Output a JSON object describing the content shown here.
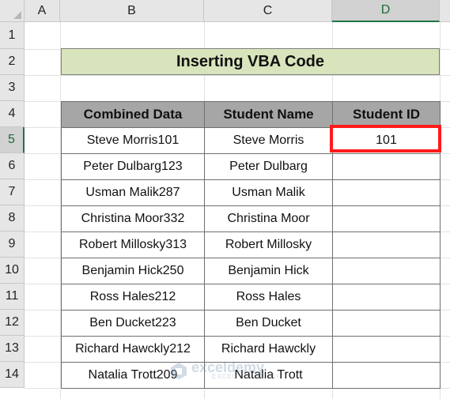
{
  "columns": [
    "A",
    "B",
    "C",
    "D"
  ],
  "rows": [
    "1",
    "2",
    "3",
    "4",
    "5",
    "6",
    "7",
    "8",
    "9",
    "10",
    "11",
    "12",
    "13",
    "14"
  ],
  "title": "Inserting VBA Code",
  "table": {
    "headers": [
      "Combined Data",
      "Student Name",
      "Student ID"
    ],
    "rows": [
      [
        "Steve Morris101",
        "Steve Morris",
        "101"
      ],
      [
        "Peter Dulbarg123",
        "Peter Dulbarg",
        ""
      ],
      [
        "Usman Malik287",
        "Usman Malik",
        ""
      ],
      [
        "Christina Moor332",
        "Christina Moor",
        ""
      ],
      [
        "Robert Millosky313",
        "Robert Millosky",
        ""
      ],
      [
        "Benjamin Hick250",
        "Benjamin Hick",
        ""
      ],
      [
        "Ross Hales212",
        "Ross Hales",
        ""
      ],
      [
        "Ben Ducket223",
        "Ben Ducket",
        ""
      ],
      [
        "Richard Hawckly212",
        "Richard Hawckly",
        ""
      ],
      [
        "Natalia Trott209",
        "Natalia Trott",
        ""
      ]
    ]
  },
  "selected": {
    "column": "D",
    "row": "5"
  },
  "colors": {
    "title_fill": "#d8e4bc",
    "header_fill": "#a6a6a6",
    "selection": "#ff1a1a"
  },
  "watermark": {
    "name": "exceldemy",
    "tagline": "EXCEL · DATA · BI"
  }
}
